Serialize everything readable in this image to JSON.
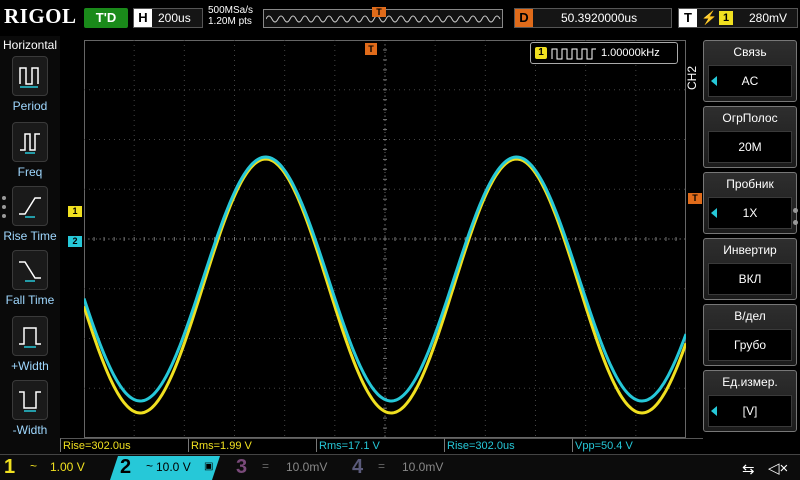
{
  "top": {
    "logo": "RIGOL",
    "run_state": "T'D",
    "timebase_letter": "H",
    "timebase": "200us",
    "sample_rate": "500MSa/s",
    "memory_depth": "1.20M pts",
    "trigger_pos_marker": "T",
    "delay_letter": "D",
    "delay": "50.3920000us",
    "trigger_letter": "T",
    "trigger_edge": "rising-edge-icon",
    "trigger_source": "1",
    "trigger_level": "280mV"
  },
  "left_panel": {
    "title": "Horizontal",
    "items": [
      {
        "label": "Period",
        "icon": "period-icon"
      },
      {
        "label": "Freq",
        "icon": "freq-icon"
      },
      {
        "label": "Rise Time",
        "icon": "rise-time-icon"
      },
      {
        "label": "Fall Time",
        "icon": "fall-time-icon"
      },
      {
        "label": "+Width",
        "icon": "pos-width-icon"
      },
      {
        "label": "-Width",
        "icon": "neg-width-icon"
      }
    ]
  },
  "frequency_counter": {
    "channel": "1",
    "value": "1.00000kHz"
  },
  "markers": {
    "ch1": "1",
    "ch2": "2",
    "trigger_position": "T",
    "trigger_level": "T"
  },
  "right_menu": {
    "channel_label": "CH2",
    "items": [
      {
        "title": "Связь",
        "value": "AC"
      },
      {
        "title": "ОгрПолос",
        "value": "20M"
      },
      {
        "title": "Пробник",
        "value": "1X"
      },
      {
        "title": "Инвертир",
        "value": "ВКЛ"
      },
      {
        "title": "В/дел",
        "value": "Грубо"
      },
      {
        "title": "Ед.измер.",
        "value": "[V]"
      }
    ]
  },
  "measurements": [
    {
      "text": "Rise=302.0us",
      "color": "#f0e020"
    },
    {
      "text": "Rms=1.99 V",
      "color": "#f0e020"
    },
    {
      "text": "Rms=17.1 V",
      "color": "#26c8d8"
    },
    {
      "text": "Rise=302.0us",
      "color": "#26c8d8"
    },
    {
      "text": "Vpp=50.4 V",
      "color": "#26c8d8"
    }
  ],
  "channels": [
    {
      "num": "1",
      "coupling": "~",
      "scale": "1.00 V",
      "color": "#f0e020"
    },
    {
      "num": "2",
      "coupling": "~",
      "scale": "10.0 V",
      "color": "#26c8d8"
    },
    {
      "num": "3",
      "coupling": "=",
      "scale": "10.0mV",
      "color": "#6a3a6a"
    },
    {
      "num": "4",
      "coupling": "=",
      "scale": "10.0mV",
      "color": "#4a4a6a"
    }
  ],
  "colors": {
    "ch1": "#f0e020",
    "ch2": "#26c8d8",
    "trigger": "#e06b1a",
    "run_state": "#1a8a1a"
  },
  "status_icons": {
    "usb": "usb-icon",
    "sound": "speaker-muted-icon"
  }
}
